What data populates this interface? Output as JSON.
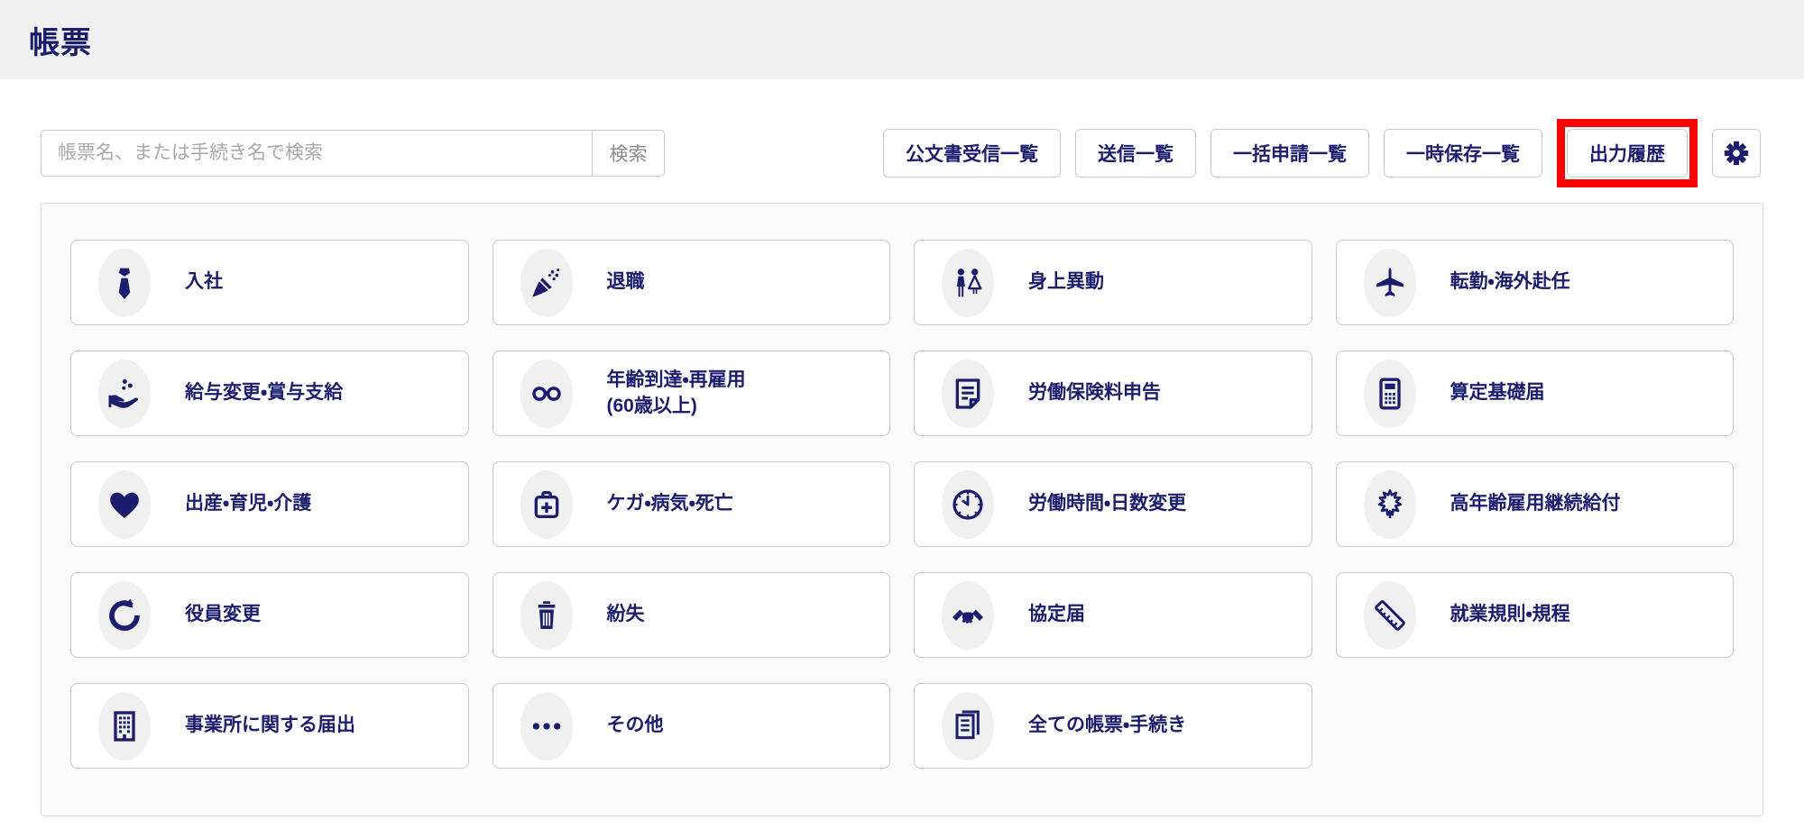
{
  "header": {
    "title": "帳票"
  },
  "toolbar": {
    "search": {
      "placeholder": "帳票名、または手続き名で検索",
      "button_label": "検索"
    },
    "buttons": [
      {
        "label": "公文書受信一覧",
        "highlighted": false
      },
      {
        "label": "送信一覧",
        "highlighted": false
      },
      {
        "label": "一括申請一覧",
        "highlighted": false
      },
      {
        "label": "一時保存一覧",
        "highlighted": false
      },
      {
        "label": "出力履歴",
        "highlighted": true
      }
    ],
    "settings_icon": "gear-icon"
  },
  "colors": {
    "accent_navy": "#1b1e6e",
    "highlight_red": "#ff0000",
    "header_bg": "#f0f0f0"
  },
  "categories": [
    {
      "label": "入社",
      "icon": "necktie-icon"
    },
    {
      "label": "退職",
      "icon": "party-popper-icon"
    },
    {
      "label": "身上異動",
      "icon": "wedding-couple-icon"
    },
    {
      "label": "転勤・海外赴任",
      "icon": "airplane-icon"
    },
    {
      "label": "給与変更・賞与支給",
      "icon": "hand-coins-icon"
    },
    {
      "label": "年齢到達・再雇用\n(60歳以上)",
      "icon": "glasses-icon"
    },
    {
      "label": "労働保険料申告",
      "icon": "document-icon"
    },
    {
      "label": "算定基礎届",
      "icon": "calculator-icon"
    },
    {
      "label": "出産・育児・介護",
      "icon": "heart-icon"
    },
    {
      "label": "ケガ・病気・死亡",
      "icon": "first-aid-kit-icon"
    },
    {
      "label": "労働時間・日数変更",
      "icon": "clock-icon"
    },
    {
      "label": "高年齢雇用継続給付",
      "icon": "maple-leaf-icon"
    },
    {
      "label": "役員変更",
      "icon": "refresh-arrow-icon"
    },
    {
      "label": "紛失",
      "icon": "trash-icon"
    },
    {
      "label": "協定届",
      "icon": "handshake-icon"
    },
    {
      "label": "就業規則・規程",
      "icon": "ruler-icon"
    },
    {
      "label": "事業所に関する届出",
      "icon": "building-icon"
    },
    {
      "label": "その他",
      "icon": "ellipsis-icon"
    },
    {
      "label": "全ての帳票・手続き",
      "icon": "documents-icon"
    }
  ]
}
